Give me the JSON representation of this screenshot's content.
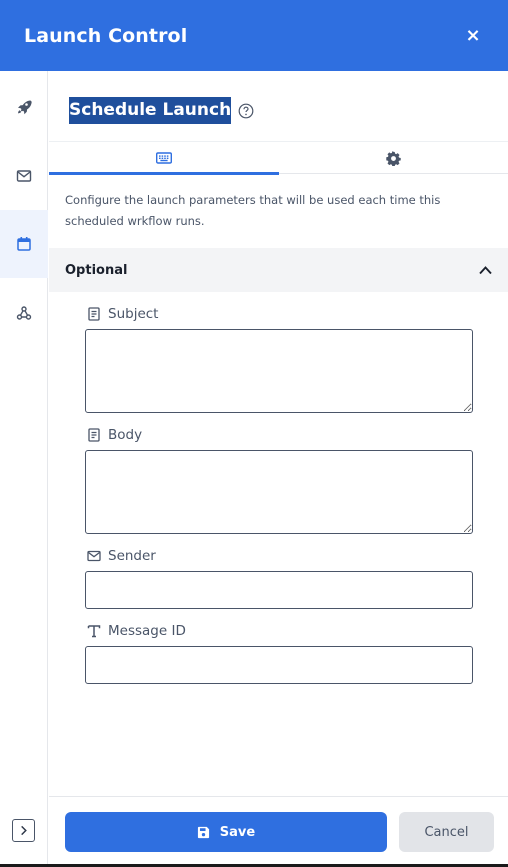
{
  "header": {
    "title": "Launch Control",
    "close_label": "×"
  },
  "rail": {
    "items": [
      {
        "name": "rocket-icon",
        "active": false
      },
      {
        "name": "envelope-icon",
        "active": false
      },
      {
        "name": "calendar-icon",
        "active": true
      },
      {
        "name": "webhook-icon",
        "active": false
      }
    ],
    "expand_icon": "chevron-right-icon"
  },
  "page": {
    "title": "Schedule Launch",
    "help_icon": "question-circle-icon"
  },
  "tabs": [
    {
      "icon": "keyboard-icon",
      "active": true
    },
    {
      "icon": "gear-icon",
      "active": false
    }
  ],
  "description": "Configure the launch parameters that will be used each time this scheduled wrkflow runs.",
  "section": {
    "title": "Optional",
    "expanded": true
  },
  "fields": {
    "subject": {
      "label": "Subject",
      "value": "",
      "icon": "document-icon"
    },
    "body": {
      "label": "Body",
      "value": "",
      "icon": "document-icon"
    },
    "sender": {
      "label": "Sender",
      "value": "",
      "icon": "envelope-icon"
    },
    "message_id": {
      "label": "Message ID",
      "value": "",
      "icon": "text-icon"
    }
  },
  "footer": {
    "save_label": "Save",
    "cancel_label": "Cancel"
  },
  "colors": {
    "primary": "#2f6fe0",
    "highlight": "#1f4f9c",
    "section_bg": "#f3f4f6"
  }
}
